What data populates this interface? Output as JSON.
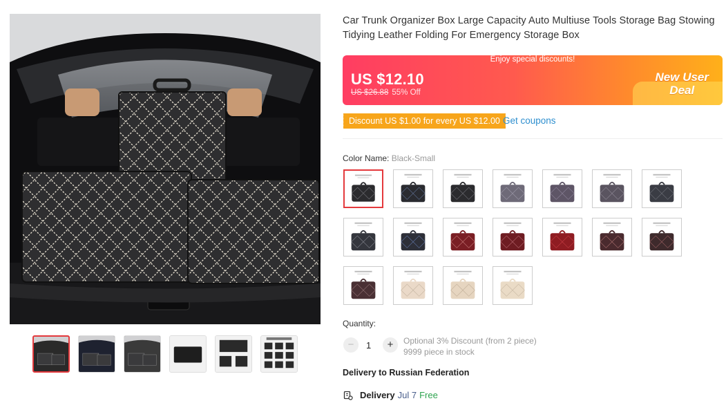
{
  "product": {
    "title": "Car Trunk Organizer Box Large Capacity Auto Multiuse Tools Storage Bag Stowing Tidying Leather Folding For Emergency Storage Box"
  },
  "promo": {
    "banner": "Enjoy special discounts!",
    "price": "US $12.10",
    "original_price": "US $26.88",
    "discount": "55% Off",
    "badge_line1": "New User",
    "badge_line2": "Deal",
    "colors": {
      "start": "#ff3d62",
      "end": "#ffb01a"
    }
  },
  "coupon": {
    "text": "Discount US $1.00 for every US $12.00",
    "link": "Get coupons",
    "color": "#f7a51b"
  },
  "color_option": {
    "label": "Color Name:",
    "selected": "Black-Small",
    "swatches": [
      {
        "fill": "#2b2b2e",
        "stitch": "#6a6a70"
      },
      {
        "fill": "#2a2b30",
        "stitch": "#5a6a8a"
      },
      {
        "fill": "#2b2b2e",
        "stitch": "#6a6a70"
      },
      {
        "fill": "#6e6a78",
        "stitch": "#9a96a6"
      },
      {
        "fill": "#5e5566",
        "stitch": "#8a8096"
      },
      {
        "fill": "#5a5460",
        "stitch": "#8a8490"
      },
      {
        "fill": "#3a3c44",
        "stitch": "#6a6c74"
      },
      {
        "fill": "#34363d",
        "stitch": "#7b7d86"
      },
      {
        "fill": "#2d2f38",
        "stitch": "#5b6e9a"
      },
      {
        "fill": "#7a1e24",
        "stitch": "#c07070"
      },
      {
        "fill": "#6e1c22",
        "stitch": "#b06068"
      },
      {
        "fill": "#8f1c22",
        "stitch": "#c03a40"
      },
      {
        "fill": "#4a2a2e",
        "stitch": "#a06868"
      },
      {
        "fill": "#3e2a2c",
        "stitch": "#905a5c"
      },
      {
        "fill": "#4a3034",
        "stitch": "#8a6a6c"
      },
      {
        "fill": "#ead9c8",
        "stitch": "#c8b8a4"
      },
      {
        "fill": "#e6d5c0",
        "stitch": "#c4b29c"
      },
      {
        "fill": "#eadbc6",
        "stitch": "#cbbba6"
      }
    ]
  },
  "quantity": {
    "label": "Quantity:",
    "value": "1",
    "minus": "−",
    "plus": "+",
    "optional_discount": "Optional 3% Discount (from 2 piece)",
    "stock": "9999 piece in stock"
  },
  "delivery": {
    "heading": "Delivery to Russian Federation",
    "label": "Delivery",
    "date": "Jul 7",
    "cost": "Free"
  },
  "gallery": {
    "thumb_count": 6,
    "selected_index": 0,
    "thumb_tints": [
      "#2a2a2a",
      "#1e2230",
      "#3a3a3a",
      "#222222",
      "#f2f2f2",
      "#f2f2f2"
    ]
  }
}
